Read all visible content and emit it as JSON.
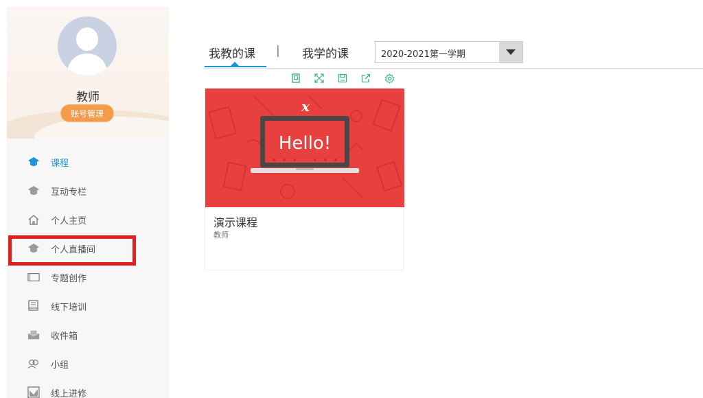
{
  "profile": {
    "role_name": "教师",
    "account_button": "账号管理"
  },
  "nav": {
    "items": [
      {
        "label": "课程",
        "icon": "graduation-cap-icon",
        "active": true
      },
      {
        "label": "互动专栏",
        "icon": "graduation-cap-icon",
        "active": false
      },
      {
        "label": "个人主页",
        "icon": "home-icon",
        "active": false
      },
      {
        "label": "个人直播间",
        "icon": "graduation-cap-icon",
        "active": false,
        "highlighted": true
      },
      {
        "label": "专题创作",
        "icon": "window-icon",
        "active": false
      },
      {
        "label": "线下培训",
        "icon": "book-icon",
        "active": false
      },
      {
        "label": "收件箱",
        "icon": "inbox-icon",
        "active": false
      },
      {
        "label": "小组",
        "icon": "group-icon",
        "active": false
      },
      {
        "label": "线上进修",
        "icon": "chart-icon",
        "active": false
      }
    ]
  },
  "tabs": {
    "taught": "我教的课",
    "separator": "|",
    "learned": "我学的课"
  },
  "semester_select": {
    "value": "2020-2021第一学期"
  },
  "course_toolbar": [
    "copy-icon",
    "fullscreen-icon",
    "save-icon",
    "share-icon",
    "settings-icon"
  ],
  "course": {
    "title": "演示课程",
    "teacher": "教师",
    "cover_text": "Hello!",
    "cover_logo": "x",
    "cover_color": "#e8403f"
  },
  "colors": {
    "accent": "#1a94d4",
    "highlight": "#e02020",
    "account_button": "#f29b4b"
  }
}
